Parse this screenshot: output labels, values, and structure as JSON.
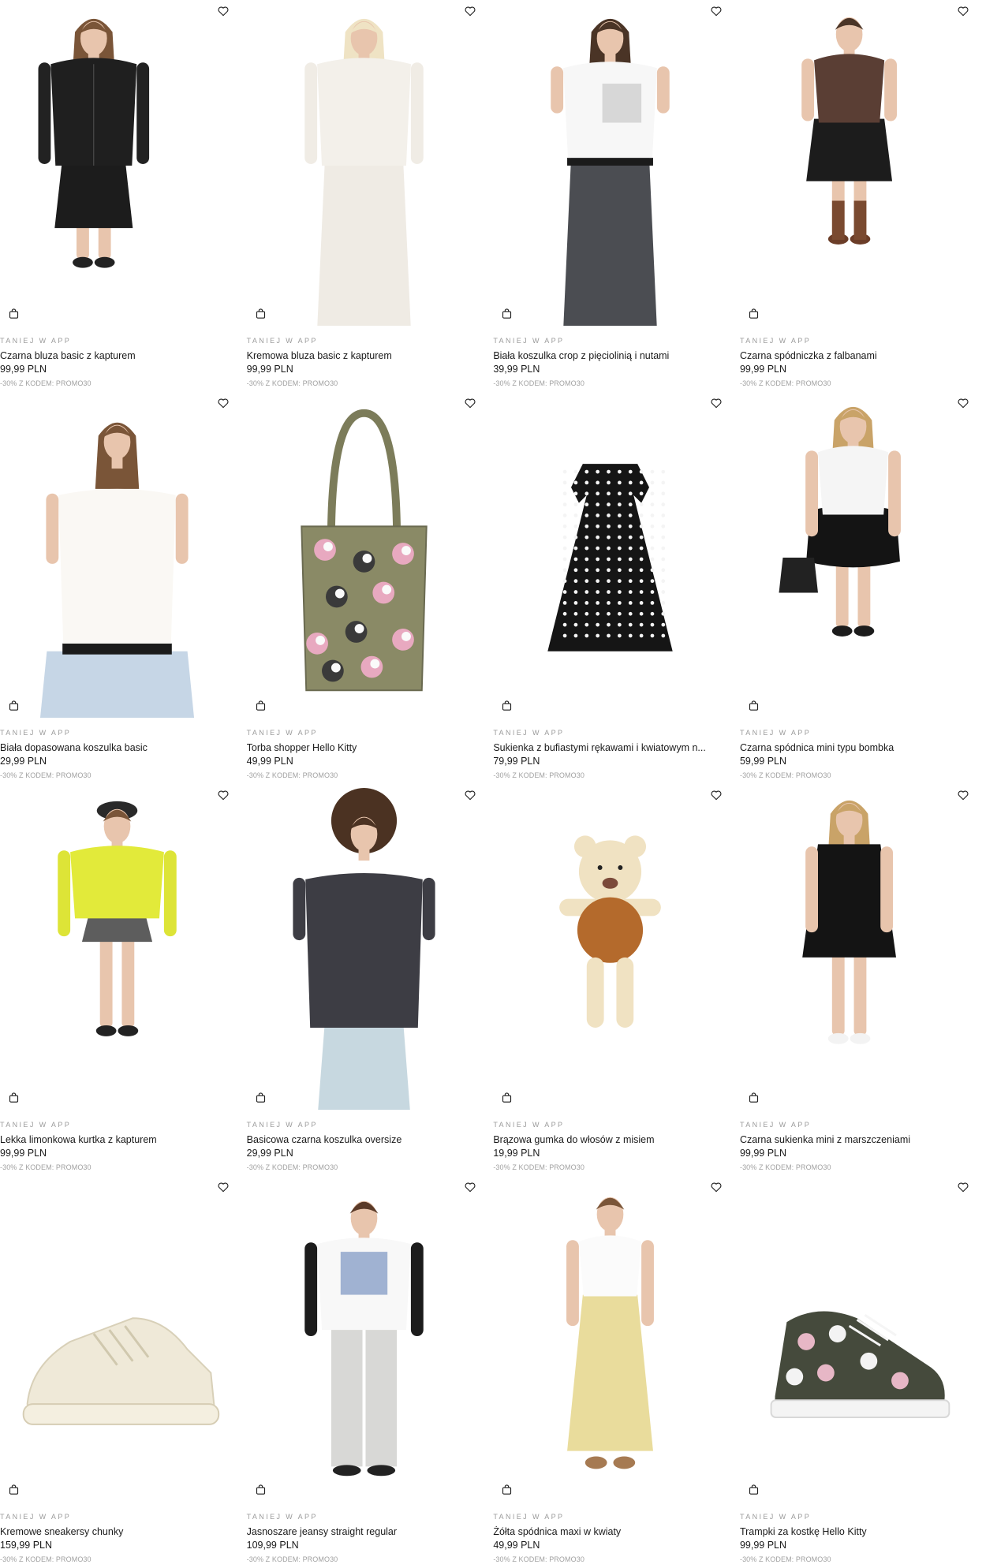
{
  "products": [
    {
      "tag": "TANIEJ W APP",
      "name": "Czarna bluza basic z kapturem",
      "price": "99,99 PLN",
      "code": "-30% Z KODEM: PROMO30",
      "image": "model-black-zip-hoodie"
    },
    {
      "tag": "TANIEJ W APP",
      "name": "Kremowa bluza basic z kapturem",
      "price": "99,99 PLN",
      "code": "-30% Z KODEM: PROMO30",
      "image": "model-cream-zip-hoodie"
    },
    {
      "tag": "TANIEJ W APP",
      "name": "Biała koszulka crop z pięciolinią i nutami",
      "price": "39,99 PLN",
      "code": "-30% Z KODEM: PROMO30",
      "image": "model-white-crop-tee"
    },
    {
      "tag": "TANIEJ W APP",
      "name": "Czarna spódniczka z falbanami",
      "price": "99,99 PLN",
      "code": "-30% Z KODEM: PROMO30",
      "image": "model-black-ruffle-skirt"
    },
    {
      "tag": "TANIEJ W APP",
      "name": "Biała dopasowana koszulka basic",
      "price": "29,99 PLN",
      "code": "-30% Z KODEM: PROMO30",
      "image": "model-white-fitted-tee"
    },
    {
      "tag": "TANIEJ W APP",
      "name": "Torba shopper Hello Kitty",
      "price": "49,99 PLN",
      "code": "-30% Z KODEM: PROMO30",
      "image": "hello-kitty-tote-bag"
    },
    {
      "tag": "TANIEJ W APP",
      "name": "Sukienka z bufiastymi rękawami i kwiatowym n...",
      "price": "79,99 PLN",
      "code": "-30% Z KODEM: PROMO30",
      "image": "black-polka-dress"
    },
    {
      "tag": "TANIEJ W APP",
      "name": "Czarna spódnica mini typu bombka",
      "price": "59,99 PLN",
      "code": "-30% Z KODEM: PROMO30",
      "image": "model-black-bubble-skirt"
    },
    {
      "tag": "TANIEJ W APP",
      "name": "Lekka limonkowa kurtka z kapturem",
      "price": "99,99 PLN",
      "code": "-30% Z KODEM: PROMO30",
      "image": "model-lime-jacket"
    },
    {
      "tag": "TANIEJ W APP",
      "name": "Basicowa czarna koszulka oversize",
      "price": "29,99 PLN",
      "code": "-30% Z KODEM: PROMO30",
      "image": "model-black-oversize-tee"
    },
    {
      "tag": "TANIEJ W APP",
      "name": "Brązowa gumka do włosów z misiem",
      "price": "19,99 PLN",
      "code": "-30% Z KODEM: PROMO30",
      "image": "teddy-scrunchie"
    },
    {
      "tag": "TANIEJ W APP",
      "name": "Czarna sukienka mini z marszczeniami",
      "price": "99,99 PLN",
      "code": "-30% Z KODEM: PROMO30",
      "image": "model-black-mini-dress"
    },
    {
      "tag": "TANIEJ W APP",
      "name": "Kremowe sneakersy chunky",
      "price": "159,99 PLN",
      "code": "-30% Z KODEM: PROMO30",
      "image": "cream-chunky-sneaker"
    },
    {
      "tag": "TANIEJ W APP",
      "name": "Jasnoszare jeansy straight regular",
      "price": "109,99 PLN",
      "code": "-30% Z KODEM: PROMO30",
      "image": "model-grey-jeans"
    },
    {
      "tag": "TANIEJ W APP",
      "name": "Żółta spódnica maxi w kwiaty",
      "price": "49,99 PLN",
      "code": "-30% Z KODEM: PROMO30",
      "image": "model-yellow-maxi-skirt"
    },
    {
      "tag": "TANIEJ W APP",
      "name": "Trampki za kostkę Hello Kitty",
      "price": "99,99 PLN",
      "code": "-30% Z KODEM: PROMO30",
      "image": "hello-kitty-high-tops"
    }
  ],
  "icons": {
    "wishlist": "heart-outline-icon",
    "add_to_cart": "shopping-bag-icon"
  },
  "colors": {
    "text": "#1a1a1a",
    "muted": "#9a9a9a",
    "background": "#ffffff"
  }
}
